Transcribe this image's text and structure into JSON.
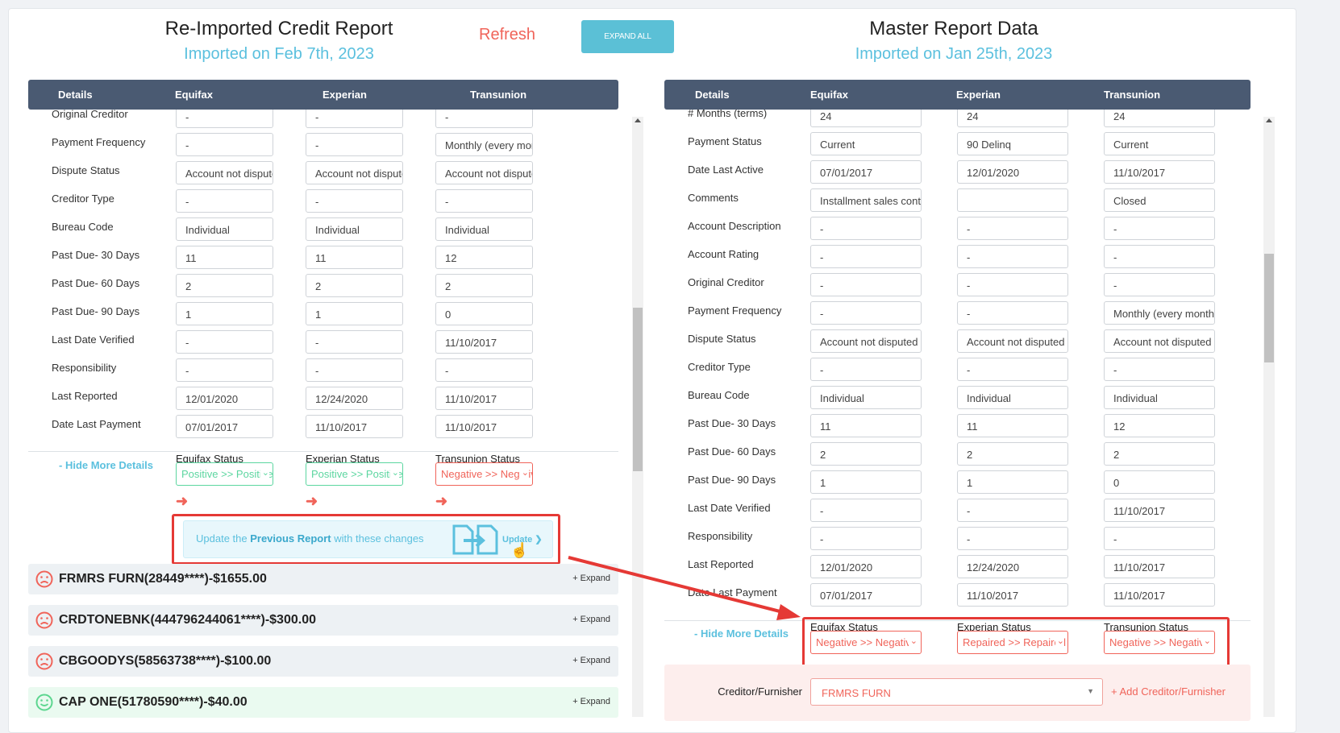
{
  "left": {
    "title": "Re-Imported Credit Report",
    "subtitle": "Imported on Feb 7th, 2023",
    "columns": [
      "Details",
      "Equifax",
      "Experian",
      "Transunion"
    ],
    "rows": [
      {
        "label": "Original Creditor",
        "values": [
          "-",
          "-",
          "-"
        ]
      },
      {
        "label": "Payment Frequency",
        "values": [
          "-",
          "-",
          "Monthly (every month)"
        ]
      },
      {
        "label": "Dispute Status",
        "values": [
          "Account not disputed",
          "Account not disputed",
          "Account not disputed"
        ]
      },
      {
        "label": "Creditor Type",
        "values": [
          "-",
          "-",
          "-"
        ]
      },
      {
        "label": "Bureau Code",
        "values": [
          "Individual",
          "Individual",
          "Individual"
        ]
      },
      {
        "label": "Past Due- 30 Days",
        "values": [
          "11",
          "11",
          "12"
        ]
      },
      {
        "label": "Past Due- 60 Days",
        "values": [
          "2",
          "2",
          "2"
        ]
      },
      {
        "label": "Past Due- 90 Days",
        "values": [
          "1",
          "1",
          "0"
        ]
      },
      {
        "label": "Last Date Verified",
        "values": [
          "-",
          "-",
          "11/10/2017"
        ]
      },
      {
        "label": "Responsibility",
        "values": [
          "-",
          "-",
          "-"
        ]
      },
      {
        "label": "Last Reported",
        "values": [
          "12/01/2020",
          "12/24/2020",
          "11/10/2017"
        ]
      },
      {
        "label": "Date Last Payment",
        "values": [
          "07/01/2017",
          "11/10/2017",
          "11/10/2017"
        ]
      }
    ],
    "hide_details": "- Hide More Details",
    "statuses": [
      {
        "label": "Equifax Status",
        "value": "Positive >> Positive",
        "kind": "positive"
      },
      {
        "label": "Experian Status",
        "value": "Positive >> Positive",
        "kind": "positive"
      },
      {
        "label": "Transunion Status",
        "value": "Negative >> Negative",
        "kind": "negative"
      }
    ],
    "update_box": {
      "pre": "Update the ",
      "bold": "Previous Report",
      "post": " with these changes",
      "link": "Update"
    },
    "accounts": [
      {
        "name": "FRMRS FURN(28449****)-$1655.00",
        "expand": "+ Expand",
        "sentiment": "negative"
      },
      {
        "name": "CRDTONEBNK(444796244061****)-$300.00",
        "expand": "+ Expand",
        "sentiment": "negative"
      },
      {
        "name": "CBGOODYS(58563738****)-$100.00",
        "expand": "+ Expand",
        "sentiment": "negative"
      },
      {
        "name": "CAP ONE(51780590****)-$40.00",
        "expand": "+ Expand",
        "sentiment": "positive"
      }
    ]
  },
  "toolbar": {
    "refresh": "Refresh",
    "expand_all": "EXPAND ALL"
  },
  "right": {
    "title": "Master Report Data",
    "subtitle": "Imported on Jan 25th, 2023",
    "columns": [
      "Details",
      "Equifax",
      "Experian",
      "Transunion"
    ],
    "rows": [
      {
        "label": "# Months (terms)",
        "values": [
          "24",
          "24",
          "24"
        ]
      },
      {
        "label": "Payment Status",
        "values": [
          "Current",
          "90 Delinq",
          "Current"
        ]
      },
      {
        "label": "Date Last Active",
        "values": [
          "07/01/2017",
          "12/01/2020",
          "11/10/2017"
        ]
      },
      {
        "label": "Comments",
        "values": [
          "Installment sales contract",
          "",
          "Closed"
        ]
      },
      {
        "label": "Account Description",
        "values": [
          "-",
          "-",
          "-"
        ]
      },
      {
        "label": "Account Rating",
        "values": [
          "-",
          "-",
          "-"
        ]
      },
      {
        "label": "Original Creditor",
        "values": [
          "-",
          "-",
          "-"
        ]
      },
      {
        "label": "Payment Frequency",
        "values": [
          "-",
          "-",
          "Monthly (every month)"
        ]
      },
      {
        "label": "Dispute Status",
        "values": [
          "Account not disputed",
          "Account not disputed",
          "Account not disputed"
        ]
      },
      {
        "label": "Creditor Type",
        "values": [
          "-",
          "-",
          "-"
        ]
      },
      {
        "label": "Bureau Code",
        "values": [
          "Individual",
          "Individual",
          "Individual"
        ]
      },
      {
        "label": "Past Due- 30 Days",
        "values": [
          "11",
          "11",
          "12"
        ]
      },
      {
        "label": "Past Due- 60 Days",
        "values": [
          "2",
          "2",
          "2"
        ]
      },
      {
        "label": "Past Due- 90 Days",
        "values": [
          "1",
          "1",
          "0"
        ]
      },
      {
        "label": "Last Date Verified",
        "values": [
          "-",
          "-",
          "11/10/2017"
        ]
      },
      {
        "label": "Responsibility",
        "values": [
          "-",
          "-",
          "-"
        ]
      },
      {
        "label": "Last Reported",
        "values": [
          "12/01/2020",
          "12/24/2020",
          "11/10/2017"
        ]
      },
      {
        "label": "Date Last Payment",
        "values": [
          "07/01/2017",
          "11/10/2017",
          "11/10/2017"
        ]
      }
    ],
    "hide_details": "- Hide More Details",
    "statuses": [
      {
        "label": "Equifax Status",
        "value": "Negative >> Negative",
        "kind": "negative"
      },
      {
        "label": "Experian Status",
        "value": "Repaired >> Repaired",
        "kind": "negative"
      },
      {
        "label": "Transunion Status",
        "value": "Negative >> Negative",
        "kind": "negative"
      }
    ],
    "creditor": {
      "label": "Creditor/Furnisher",
      "value": "FRMRS FURN",
      "add": "+ Add Creditor/Furnisher"
    }
  },
  "colors": {
    "accent": "#5bc0de",
    "header": "#4a5a72",
    "negative": "#f0645a",
    "positive": "#5cd6a0",
    "highlight": "#e53935"
  }
}
